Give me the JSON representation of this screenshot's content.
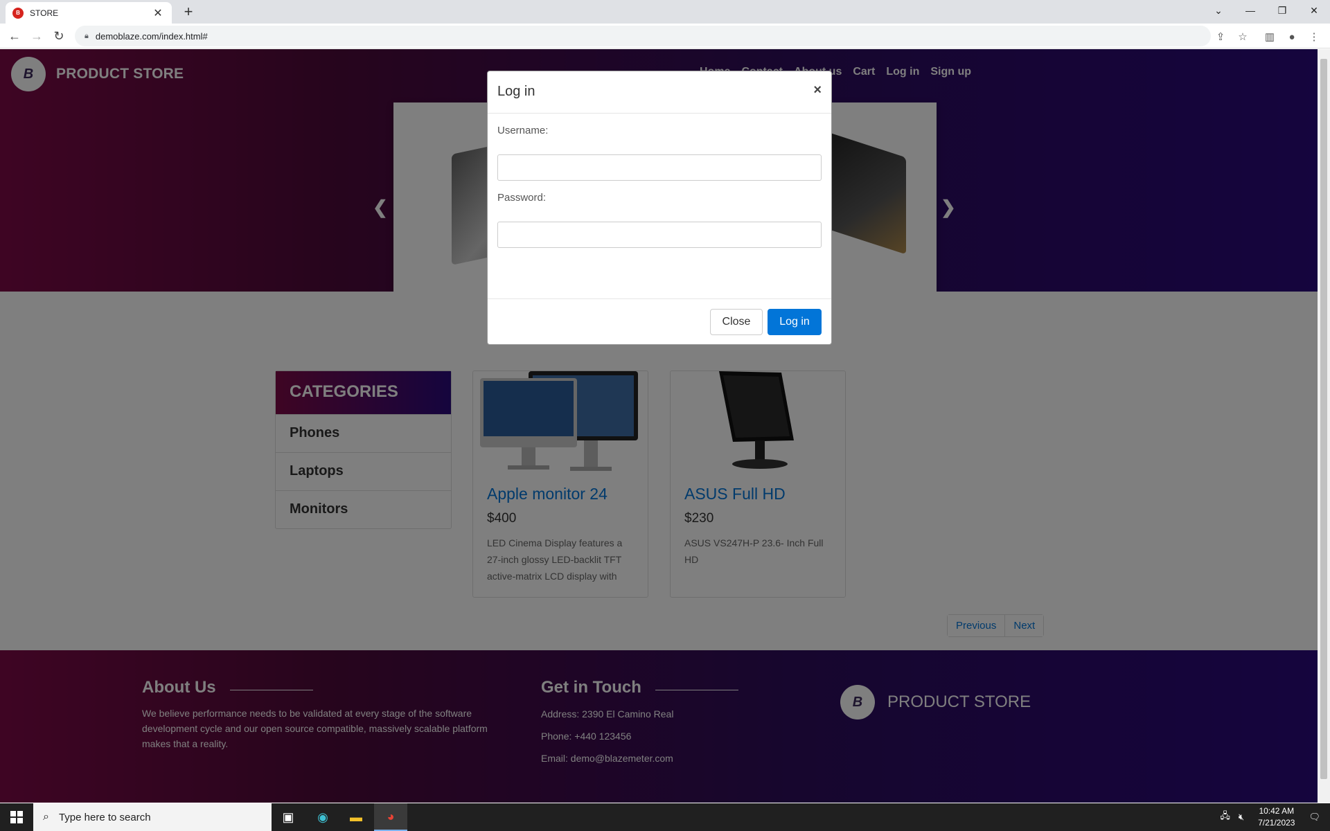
{
  "browser": {
    "tab_title": "STORE",
    "tab_favicon": "B",
    "url": "demoblaze.com/index.html#"
  },
  "site": {
    "brand": "PRODUCT STORE",
    "logo_letter": "B",
    "nav": [
      "Home",
      "Contact",
      "About us",
      "Cart",
      "Log in",
      "Sign up"
    ]
  },
  "categories": {
    "heading": "CATEGORIES",
    "items": [
      "Phones",
      "Laptops",
      "Monitors"
    ]
  },
  "products": [
    {
      "title": "Apple monitor 24",
      "price": "$400",
      "desc": "LED Cinema Display features a 27-inch glossy LED-backlit TFT active-matrix LCD display with"
    },
    {
      "title": "ASUS Full HD",
      "price": "$230",
      "desc": "ASUS VS247H-P 23.6- Inch Full HD"
    }
  ],
  "pager": {
    "prev": "Previous",
    "next": "Next"
  },
  "footer": {
    "about_title": "About Us",
    "about_text": "We believe performance needs to be validated at every stage of the software development cycle and our open source compatible, massively scalable platform makes that a reality.",
    "contact_title": "Get in Touch",
    "address": "Address: 2390 El Camino Real",
    "phone": "Phone: +440 123456",
    "email": "Email: demo@blazemeter.com",
    "brand": "PRODUCT STORE"
  },
  "modal": {
    "title": "Log in",
    "close_x": "×",
    "username_label": "Username:",
    "password_label": "Password:",
    "username_value": "",
    "password_value": "",
    "close_button": "Close",
    "login_button": "Log in"
  },
  "taskbar": {
    "search_placeholder": "Type here to search",
    "time": "10:42 AM",
    "date": "7/21/2023"
  },
  "colors": {
    "accent": "#0275d8",
    "hero_start": "#7d0a47",
    "hero_end": "#2a0a7c"
  }
}
